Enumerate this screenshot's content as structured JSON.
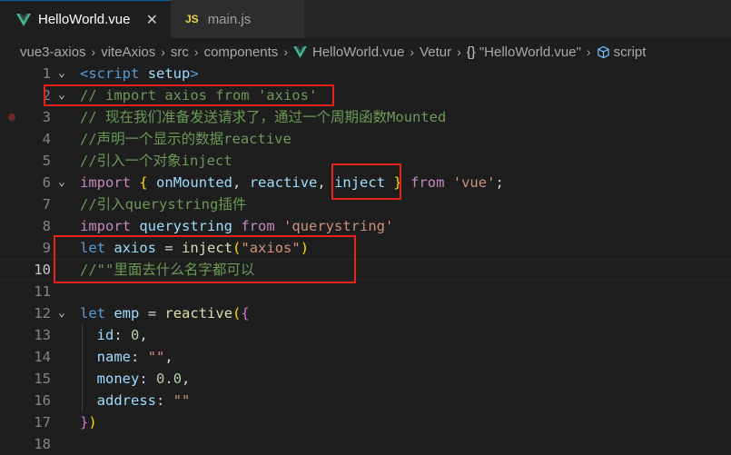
{
  "tabs": [
    {
      "label": "HelloWorld.vue",
      "icon": "vue-icon",
      "active": true
    },
    {
      "label": "main.js",
      "icon": "js-icon",
      "badge": "JS",
      "active": false
    }
  ],
  "breadcrumb": {
    "items": [
      "vue3-axios",
      "viteAxios",
      "src",
      "components",
      "HelloWorld.vue",
      "Vetur",
      "\"HelloWorld.vue\"",
      "script"
    ],
    "braces": "{}"
  },
  "editor": {
    "line_numbers": [
      "1",
      "2",
      "3",
      "4",
      "5",
      "6",
      "7",
      "8",
      "9",
      "10",
      "11",
      "12",
      "13",
      "14",
      "15",
      "16",
      "17",
      "18"
    ],
    "lines": {
      "l3": "// 现在我们准备发送请求了，通过一个周期函数Mounted",
      "l4": "//声明一个显示的数据reactive",
      "l5": "//引入一个对象inject",
      "l7": "//引入querystring插件",
      "l10": "//\"\"里面去什么名字都可以"
    },
    "tokens": {
      "script_tag_open": "<",
      "script_tag_name": "script",
      "setup": "setup",
      "tag_close": ">",
      "l2_comment": "// import axios from 'axios'",
      "import": "import",
      "brace_open": "{",
      "onMounted": "onMounted",
      "comma": ",",
      "reactive": "reactive",
      "inject": "inject",
      "brace_close": "}",
      "from": "from",
      "vue_str": "'vue'",
      "semicolon": ";",
      "querystring": "querystring",
      "querystring_str": "'querystring'",
      "let": "let",
      "axios": "axios",
      "eq": "=",
      "paren_open": "(",
      "axios_str": "\"axios\"",
      "paren_close": ")",
      "emp": "emp",
      "id": "id",
      "colon": ":",
      "zero": "0",
      "name": "name",
      "empty_str": "\"\"",
      "money": "money",
      "money_val": "0.0",
      "address": "address"
    }
  },
  "colors": {
    "highlight_box": "#e8231f",
    "comment": "#6a9955",
    "keyword": "#569cd6",
    "control": "#c586c0",
    "variable": "#9cdcfe",
    "function": "#dcdcaa",
    "string": "#ce9178"
  }
}
